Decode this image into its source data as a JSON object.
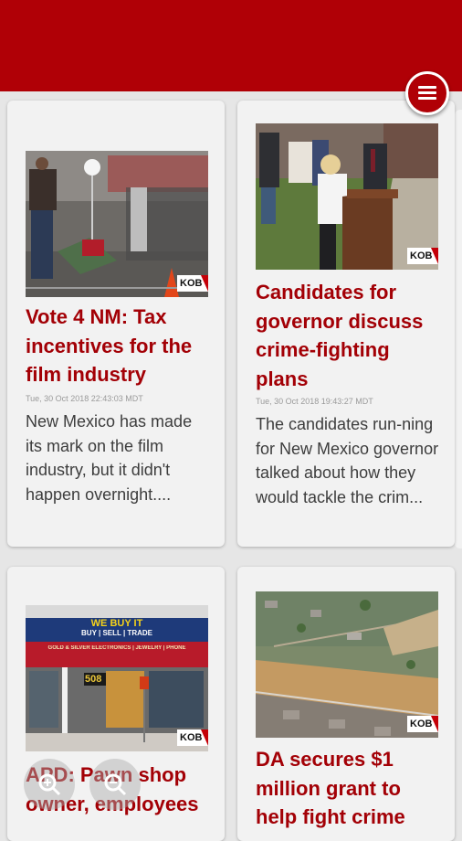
{
  "header": {
    "menu_icon": "hamburger-menu-icon"
  },
  "articles": [
    {
      "title": "Vote 4 NM: Tax incentives for the film industry",
      "date": "Tue, 30 Oct 2018 22:43:03 MDT",
      "excerpt": "New Mexico has made its mark on the film industry, but it didn't happen overnight....",
      "watermark": "KOB"
    },
    {
      "title": "Candidates for governor discuss crime-fighting plans",
      "date": "Tue, 30 Oct 2018 19:43:27 MDT",
      "excerpt": "The candidates run-ning for New Mexico governor talked about how they would tackle the crim...",
      "watermark": "KOB"
    },
    {
      "title": "APD: Pawn shop owner, employees",
      "store_sign": "WE BUY IT",
      "store_sub": "BUY | SELL | TRADE",
      "store_sub2": "GOLD & SILVER ELECTRONICS | JEWELRY | PHONE",
      "store_number": "508",
      "watermark": "KOB"
    },
    {
      "title": "DA secures $1 million grant to help fight crime",
      "watermark": "KOB"
    }
  ],
  "zoom_controls": {
    "zoom_in_icon": "zoom-in-icon",
    "zoom_out_icon": "zoom-out-icon"
  },
  "colors": {
    "brand_red": "#b00006",
    "title_red": "#a30006"
  }
}
